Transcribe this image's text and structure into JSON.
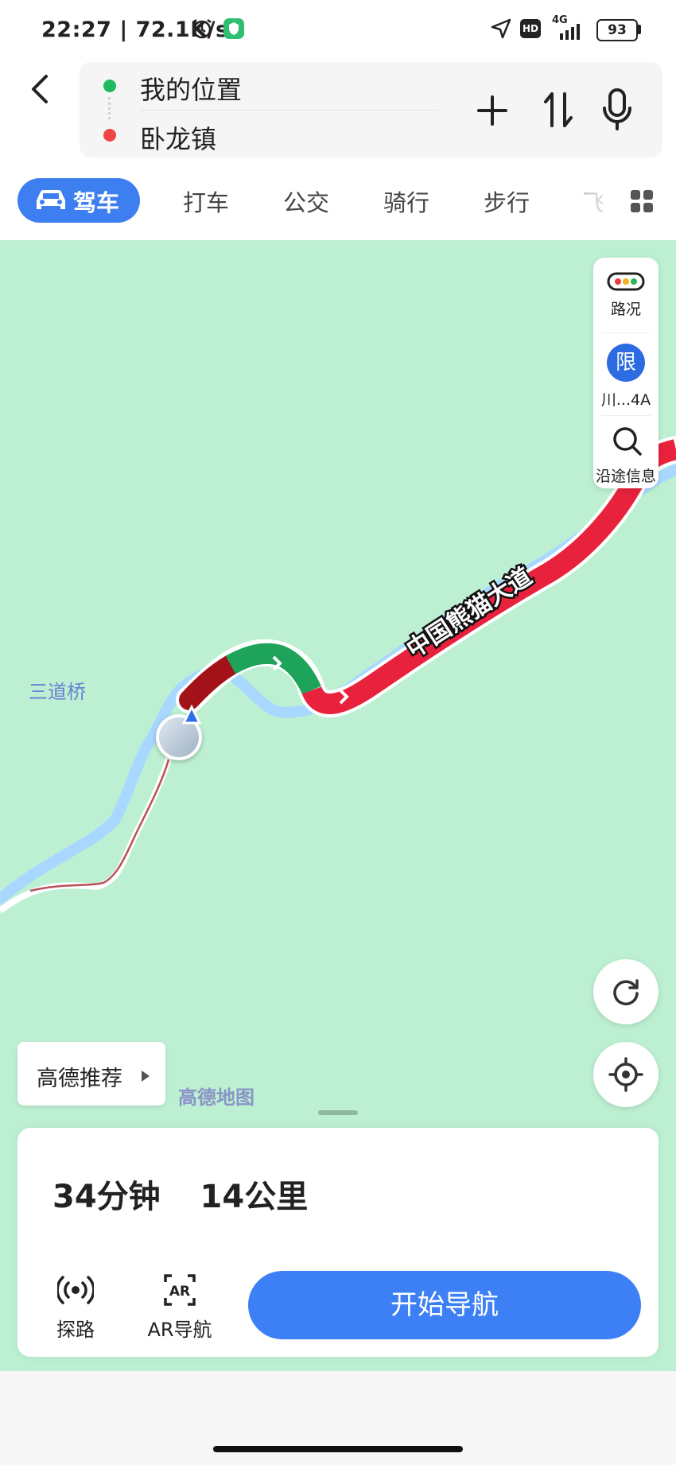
{
  "status_bar": {
    "time": "22:27 | 72.1K/s",
    "network": "4G",
    "hd": "HD",
    "battery": "93"
  },
  "route": {
    "origin": "我的位置",
    "destination": "卧龙镇"
  },
  "modes": {
    "active": "驾车",
    "taxi": "打车",
    "bus": "公交",
    "bike": "骑行",
    "walk": "步行",
    "partial": "飞"
  },
  "map": {
    "place_label": "三道桥",
    "road_label": "中国熊猫大道",
    "watermark": "高德地图",
    "recommend": "高德推荐",
    "tools": {
      "traffic": "路况",
      "limit_badge": "限",
      "limit_text": "川...4A",
      "along_route": "沿途信息"
    }
  },
  "route_summary": {
    "duration": "34分钟",
    "distance": "14公里"
  },
  "actions": {
    "explore": "探路",
    "ar": "AR导航",
    "start": "开始导航"
  },
  "colors": {
    "accent": "#3d80f6",
    "traffic_red": "#e8223c",
    "traffic_green": "#1ea35a",
    "map_bg": "#bdf0d2"
  }
}
